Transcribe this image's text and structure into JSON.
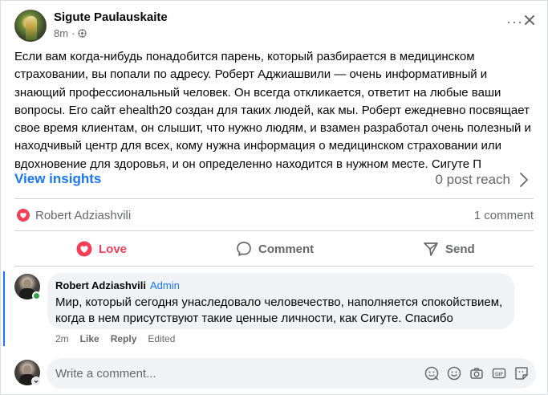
{
  "post": {
    "author": "Sigute Paulauskaite",
    "time": "8m",
    "separator": "·",
    "more": "···",
    "text": "Если вам когда-нибудь понадобится парень, который разбирается в медицинском страховании, вы попали по адресу. Роберт Аджиашвили — очень информативный и знающий профессиональный человек. Он всегда откликается, ответит на любые ваши вопросы. Его сайт ehealth20 создан для таких людей, как мы. Роберт ежедневно посвящает свое время клиентам, он слышит, что нужно людям, и взамен разработал очень полезный и находчивый центр для всех, кому нужна информация о медицинском страховании или вдохновение для здоровья, и он определенно находится в нужном месте. Сигуте П"
  },
  "insights": {
    "label": "View insights",
    "reach": "0 post reach"
  },
  "reactions": {
    "reactor": "Robert Adziashvili",
    "comment_count": "1 comment"
  },
  "actions": {
    "love": "Love",
    "comment": "Comment",
    "send": "Send"
  },
  "comment": {
    "author": "Robert Adziashvili",
    "badge": "Admin",
    "text": "Мир, который сегодня унаследовало человечество, наполняется спокойствием, когда в нем присутствуют такие ценные личности, как Сигуте. Спасибо",
    "time": "2m",
    "like": "Like",
    "reply": "Reply",
    "edited": "Edited"
  },
  "composer": {
    "placeholder": "Write a comment..."
  },
  "colors": {
    "accent": "#1877f2",
    "love": "#f33e58",
    "online": "#31a24c",
    "muted": "#65676b",
    "bubble": "#f0f2f5"
  }
}
